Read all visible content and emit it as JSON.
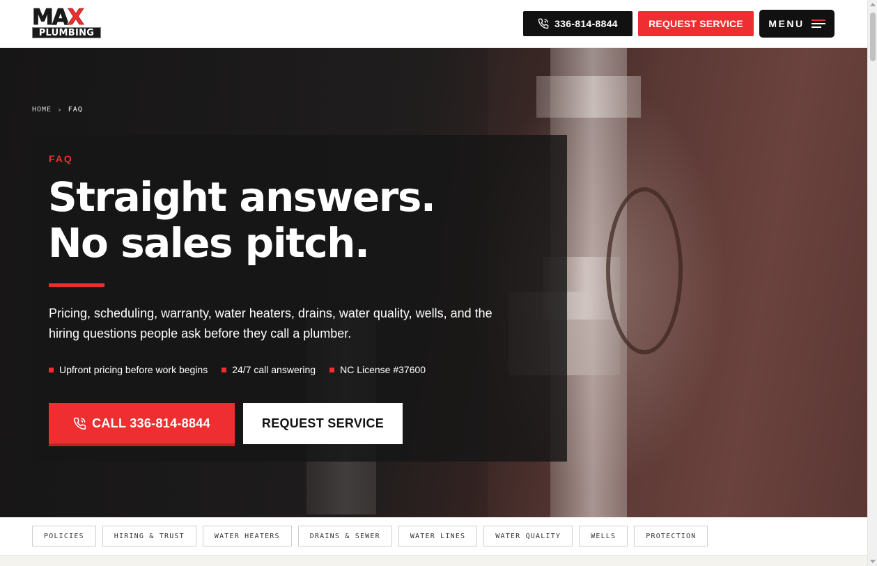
{
  "header": {
    "logo": {
      "top": "MAX",
      "bottom": "PLUMBING"
    },
    "phone_label": "336-814-8844",
    "request_label": "REQUEST SERVICE",
    "menu_label": "MENU",
    "phone_icon": "phone-icon",
    "menu_icon": "hamburger-icon"
  },
  "breadcrumb": {
    "home": "HOME",
    "separator": "›",
    "current": "FAQ"
  },
  "hero": {
    "eyebrow": "FAQ",
    "headline_line1": "Straight answers.",
    "headline_line2": "No sales pitch.",
    "lede": "Pricing, scheduling, warranty, water heaters, drains, water quality, wells, and the hiring questions people ask before they call a plumber.",
    "bullets": [
      "Upfront pricing before work begins",
      "24/7 call answering",
      "NC License #37600"
    ],
    "call_button": "CALL 336-814-8844",
    "request_button": "REQUEST SERVICE"
  },
  "tabs": [
    "POLICIES",
    "HIRING & TRUST",
    "WATER HEATERS",
    "DRAINS & SEWER",
    "WATER LINES",
    "WATER QUALITY",
    "WELLS",
    "PROTECTION"
  ],
  "colors": {
    "accent": "#ee2e30",
    "dark": "#111111",
    "text_light": "#ffffff"
  }
}
